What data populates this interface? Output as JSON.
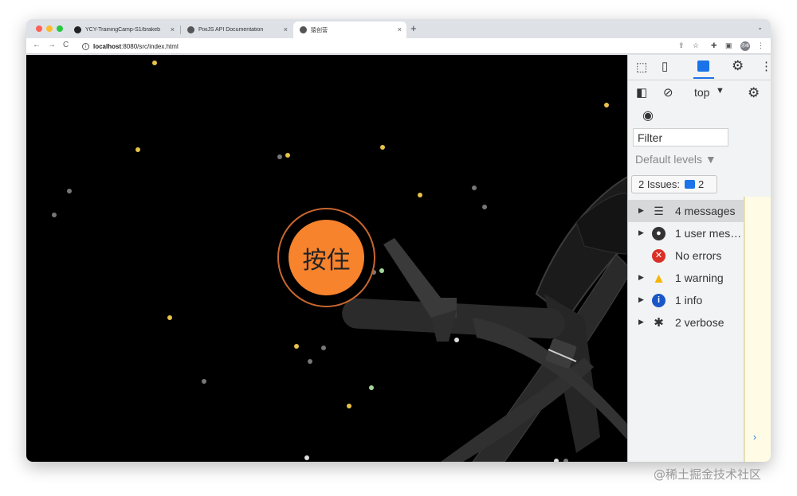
{
  "browser": {
    "tabs": [
      {
        "label": "YCY-TrainingCamp-S1/brakeb",
        "close": "×",
        "active": false
      },
      {
        "label": "PixiJS API Documentation",
        "close": "×",
        "active": false
      },
      {
        "label": "猿创营",
        "close": "×",
        "active": true
      }
    ],
    "new_tab": "+",
    "tab_menu": "⌄",
    "nav": {
      "back": "←",
      "forward": "→",
      "reload": "C"
    },
    "url_host": "localhost",
    "url_rest": ":8080/src/index.html",
    "avatar_text": "思维",
    "colors": {
      "close_red": "#fe5f57",
      "minimize_yellow": "#febc2e",
      "zoom_green": "#28c840"
    }
  },
  "page": {
    "press_button_label": "按住",
    "press_color": "#f7832d"
  },
  "devtools": {
    "context": "top",
    "filter": "Filter",
    "levels": "Default levels ▼",
    "issues_label": "2 Issues:",
    "issues_count": "2",
    "sidebar": [
      {
        "label": "4 messages",
        "icon": "list-icon",
        "expandable": true,
        "selected": true
      },
      {
        "label": "1 user mes…",
        "icon": "user-icon",
        "expandable": true,
        "selected": false
      },
      {
        "label": "No errors",
        "icon": "error-icon",
        "expandable": false,
        "selected": false
      },
      {
        "label": "1 warning",
        "icon": "warning-icon",
        "expandable": true,
        "selected": false
      },
      {
        "label": "1 info",
        "icon": "info-icon",
        "expandable": true,
        "selected": false
      },
      {
        "label": "2 verbose",
        "icon": "bug-icon",
        "expandable": true,
        "selected": false
      }
    ],
    "console_prompt": "›"
  },
  "watermark": "@稀土掘金技术社区"
}
